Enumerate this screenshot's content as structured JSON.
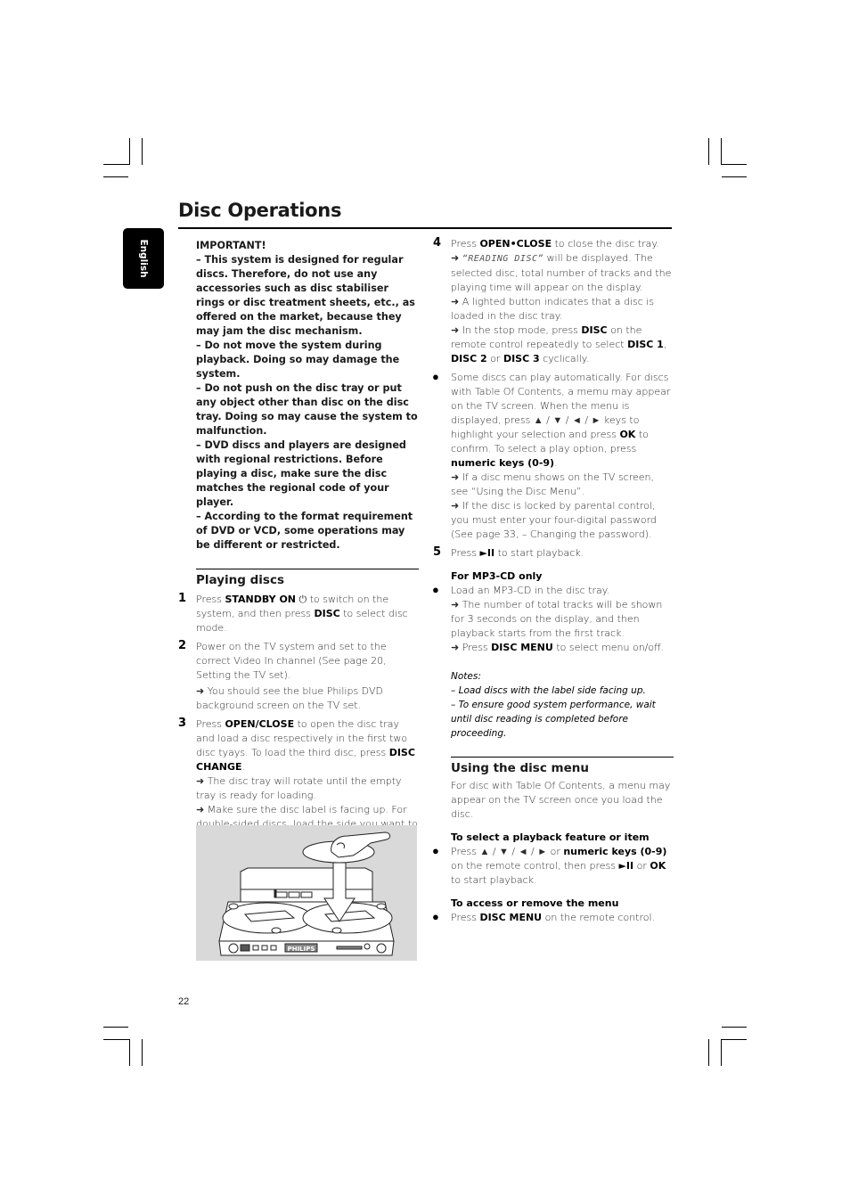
{
  "page": {
    "title": "Disc Operations",
    "language_tab": "English",
    "page_number": "22"
  },
  "important": {
    "heading": "IMPORTANT!",
    "items": [
      "–  This system is designed for regular discs. Therefore, do not use any accessories such as disc stabiliser rings or disc treatment sheets, etc., as offered on the market, because they may jam the disc mechanism.",
      "–  Do not move the system during playback. Doing so may damage the system.",
      "–  Do not push on the disc tray or put any object other than disc on the disc tray. Doing so may cause the system to malfunction.",
      "–  DVD discs and players are designed with regional restrictions. Before playing a disc, make sure the disc matches the regional code of your player.",
      "–  According to the format requirement of DVD or VCD, some operations may be different or restricted."
    ]
  },
  "playing_discs": {
    "heading": "Playing discs",
    "step1": {
      "num": "1",
      "a": "Press ",
      "b1": "STANDBY ON",
      "c": " ⏻ to switch on the system, and then press ",
      "b2": "DISC",
      "d": " to select disc mode."
    },
    "step2": {
      "num": "2",
      "text": "Power on the TV system and set to the correct Video In channel (See page 20, Setting the TV set).",
      "arrow1": "➜ You should see the blue Philips DVD background screen on the TV set."
    },
    "step3": {
      "num": "3",
      "a": "Press ",
      "b1": "OPEN/CLOSE",
      "c": " to open the disc tray and load a disc respectively in the first two disc tyays. To load the third disc, press ",
      "b2": "DISC CHANGE",
      "d": ".",
      "arrow1": "➜ The disc tray will rotate until the empty tray is ready for loading.",
      "arrow2": "➜ Make sure the disc label is facing up. For double-sided discs, load the side you want to play facing up."
    },
    "figure_label": "PHILIPS"
  },
  "right": {
    "step4": {
      "num": "4",
      "a": "Press ",
      "b1": "OPEN•CLOSE",
      "c": " to close the disc tray.",
      "arrow1_pre": "➜ ",
      "lcd": "“READING DISC”",
      "arrow1_post": " will be displayed. The selected disc, total number of tracks and the playing time will appear on the display.",
      "arrow2": "➜ A lighted button indicates that a disc is loaded in the disc tray.",
      "arrow3_a": "➜ In the stop mode, press ",
      "arrow3_b1": "DISC",
      "arrow3_c": " on the remote control repeatedly to select ",
      "arrow3_b2": "DISC 1",
      "arrow3_d": ", ",
      "arrow3_b3": "DISC 2",
      "arrow3_e": " or ",
      "arrow3_b4": "DISC 3",
      "arrow3_f": " cyclically."
    },
    "bullet1": {
      "a": "Some discs can play automatically. For discs with Table Of Contents, a memu may appear on the TV screen. When the menu is displayed, press ▲ / ▼ / ◄ / ► keys to highlight your selection and press ",
      "b1": "OK",
      "c": " to confirm. To select a play option, press ",
      "b2": "numeric keys (0-9)",
      "d": ".",
      "arrow1": "➜ If a disc menu shows on the TV screen, see “Using the Disc Menu”.",
      "arrow2": "➜ If the disc is locked by parental control, you must enter your four-digital password (See page 33, – Changing the password)."
    },
    "step5": {
      "num": "5",
      "a": "Press ",
      "b1": "►II",
      "c": " to start playback."
    },
    "mp3": {
      "heading": "For MP3-CD only",
      "text": "Load an MP3-CD in the disc tray.",
      "arrow1": "➜ The number of total tracks will be shown for 3 seconds on the display, and then playback starts from the first track.",
      "arrow2_a": "➜ Press ",
      "arrow2_b": "DISC MENU",
      "arrow2_c": " to select menu on/off."
    },
    "notes": {
      "heading": "Notes:",
      "items": [
        "–  Load discs with the label side facing up.",
        "–  To ensure good system performance, wait until disc reading is completed before proceeding."
      ]
    },
    "disc_menu": {
      "heading": "Using the disc menu",
      "intro": "For disc with Table Of Contents, a menu may appear on the TV screen once you load the disc.",
      "select_heading": "To select a playback feature or item",
      "select_a": "Press ▲ / ▼ / ◄ / ► or ",
      "select_b1": "numeric keys (0-9)",
      "select_c": " on the remote control, then press ",
      "select_b2": "►II",
      "select_d": " or ",
      "select_b3": "OK",
      "select_e": " to start playback.",
      "access_heading": "To access or remove the menu",
      "access_a": "Press ",
      "access_b": "DISC MENU",
      "access_c": " on the remote control."
    }
  },
  "bullet_glyph": "●"
}
